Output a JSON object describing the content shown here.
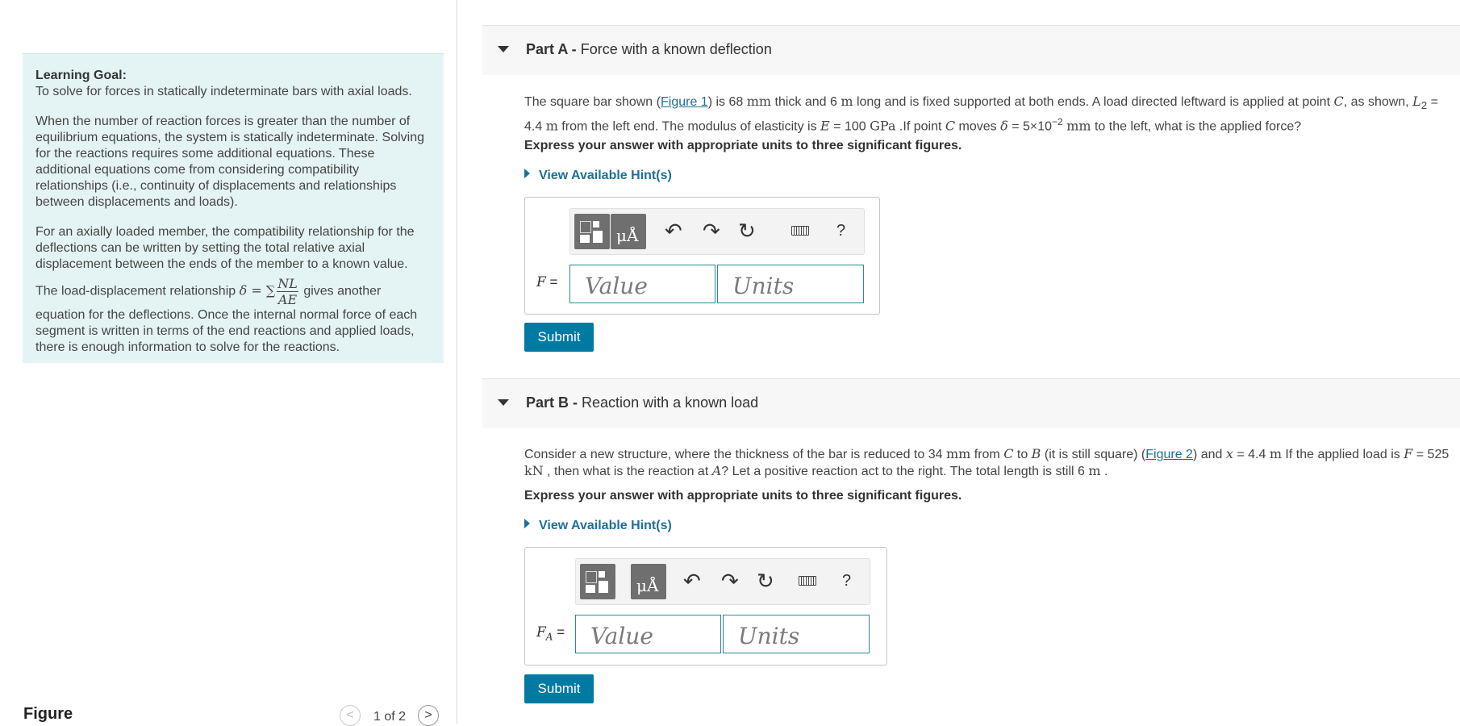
{
  "learning_goal": {
    "title": "Learning Goal:",
    "intro": "To solve for forces in statically indeterminate bars with axial loads.",
    "p1": "When the number of reaction forces is greater than the number of equilibrium equations, the system is statically indeterminate. Solving for the reactions requires some additional equations. These additional equations come from considering compatibility relationships (i.e., continuity of displacements and relationships between displacements and loads).",
    "p2": "For an axially loaded member, the compatibility relationship for the deflections can be written by setting the total relative axial displacement between the ends of the member to a known value.",
    "p3_before": "The load-displacement relationship",
    "p3_formula_lhs": "δ = ∑",
    "p3_formula_num": "NL",
    "p3_formula_den": "AE",
    "p3_after": "gives another equation for the deflections. Once the internal normal force of each segment is written in terms of the end reactions and applied loads, there is enough information to solve for the reactions."
  },
  "figure": {
    "label": "Figure",
    "pager_text": "1 of 2",
    "prev_glyph": "<",
    "next_glyph": ">"
  },
  "toolbar": {
    "units_glyph": "μÅ",
    "undo_glyph": "↶",
    "redo_glyph": "↷",
    "reset_glyph": "↻",
    "help_glyph": "?"
  },
  "part_a": {
    "prefix": "Part A -",
    "title": "Force with a known deflection",
    "t1": "The square bar shown (",
    "fig_link": "Figure 1",
    "t2": ") is 68 ",
    "u_mm1": "mm",
    "t3": " thick and 6 ",
    "u_m1": "m",
    "t4": " long and is fixed supported at both ends. A load directed leftward is applied at point ",
    "var_c1": "C",
    "t5": ", as shown, ",
    "var_l": "L",
    "sub_2": "2",
    "t6": " = 4.4 ",
    "u_m2": "m",
    "t7": " from the left end. The modulus of elasticity is ",
    "var_e": "E",
    "t8": " = 100 ",
    "u_gpa": "GPa",
    "t9": " .If point ",
    "var_c2": "C",
    "t10": " moves ",
    "delta": "δ",
    "t11": " = 5×10",
    "exp": "−2",
    "t12": " ",
    "u_mm2": "mm",
    "t13": " to the left, what is the applied force?",
    "express": "Express your answer with appropriate units to three significant figures.",
    "hint": "View Available Hint(s)",
    "field_label_var": "F",
    "field_label_eq": " =",
    "value_placeholder": "Value",
    "units_placeholder": "Units",
    "submit": "Submit"
  },
  "part_b": {
    "prefix": "Part B -",
    "title": "Reaction with a known load",
    "t1": "Consider a new structure, where the thickness of the bar is reduced to 34 ",
    "u_mm": "mm",
    "t2": " from ",
    "var_c": "C",
    "t3": " to ",
    "var_b": "B",
    "t4": " (it is still square) (",
    "fig_link": "Figure 2",
    "t5": ") and ",
    "var_x": "x",
    "t6": " = 4.4 ",
    "u_m": "m",
    "t7": " If the applied load is ",
    "var_f": "F",
    "t8": " = 525 ",
    "u_kn": "kN",
    "t9": " , then what is the reaction at ",
    "var_a": "A",
    "t10": "? Let a positive reaction act to the right. The total length is still 6 ",
    "u_m2": "m",
    "t11": " .",
    "express": "Express your answer with appropriate units to three significant figures.",
    "hint": "View Available Hint(s)",
    "field_label_var": "F",
    "field_label_sub": "A",
    "field_label_eq": " =",
    "value_placeholder": "Value",
    "units_placeholder": "Units",
    "submit": "Submit"
  },
  "colors": {
    "goal_bg": "#e4f4f4",
    "link": "#1f6f9a",
    "submit_bg": "#007aa3",
    "input_border": "#2a8a96"
  }
}
